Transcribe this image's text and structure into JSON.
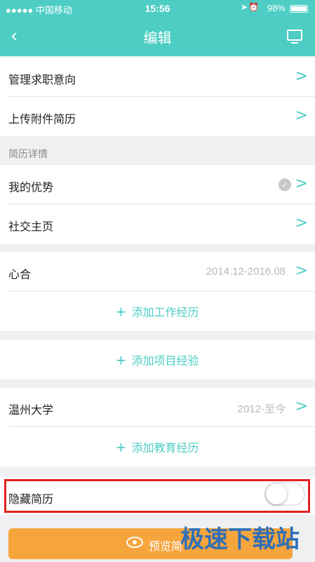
{
  "status_bar": {
    "carrier": "●●●●● 中国移动",
    "time": "15:56",
    "battery": "98%"
  },
  "nav": {
    "back_icon": "‹",
    "title": "编辑"
  },
  "rows_top": [
    {
      "label": "管理求职意向"
    },
    {
      "label": "上传附件简历"
    }
  ],
  "section_title": "简历详情",
  "rows_detail": [
    {
      "label": "我的优势"
    },
    {
      "label": "社交主页"
    }
  ],
  "work": {
    "company": "心合",
    "period": "2014.12-2016.08",
    "add_label": "添加工作经历"
  },
  "project": {
    "add_label": "添加项目经验"
  },
  "education": {
    "school": "温州大学",
    "period": "2012-至今",
    "add_label": "添加教育经历"
  },
  "hide_resume": {
    "label": "隐藏简历",
    "enabled": false
  },
  "preview": {
    "label": "预览简"
  },
  "watermark": "极速下载站",
  "colors": {
    "accent": "#4dcdc4",
    "preview_button": "#f6a53c",
    "highlight_border": "#e02020"
  }
}
